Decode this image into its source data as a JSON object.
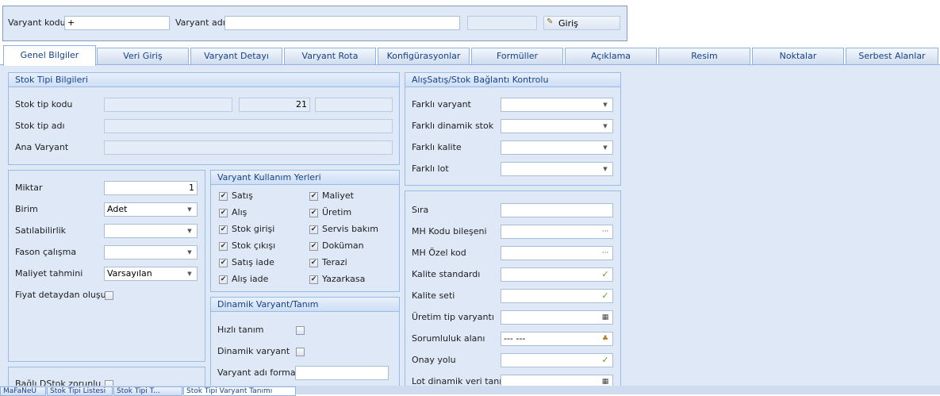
{
  "header": {
    "variant_code_label": "Varyant kodu",
    "variant_code_value": "+",
    "variant_name_label": "Varyant adı",
    "variant_name_value": "",
    "login_button": "Giriş",
    "login_icon": "pencil-edit-icon"
  },
  "tabs": [
    {
      "label": "Genel Bilgiler",
      "active": true
    },
    {
      "label": "Veri Giriş"
    },
    {
      "label": "Varyant Detayı"
    },
    {
      "label": "Varyant Rota"
    },
    {
      "label": "Konfigürasyonlar"
    },
    {
      "label": "Formüller"
    },
    {
      "label": "Açıklama"
    },
    {
      "label": "Resim"
    },
    {
      "label": "Noktalar"
    },
    {
      "label": "Serbest Alanlar"
    }
  ],
  "stock_type_panel": {
    "title": "Stok Tipi Bilgileri",
    "code_label": "Stok tip kodu",
    "code_value": "21",
    "name_label": "Stok tip adı",
    "main_variant_label": "Ana Varyant"
  },
  "general": {
    "quantity_label": "Miktar",
    "quantity_value": "1",
    "unit_label": "Birim",
    "unit_value": "Adet",
    "saleability_label": "Satılabilirlik",
    "saleability_value": "",
    "outsourcing_label": "Fason çalışma",
    "outsourcing_value": "",
    "cost_estimate_label": "Maliyet tahmini",
    "cost_estimate_value": "Varsayılan",
    "price_detail_label": "Fiyat detaydan oluşur",
    "linked_stock_label": "Bağlı DStok zorunlu"
  },
  "usage_panel": {
    "title": "Varyant Kullanım Yerleri",
    "left": [
      {
        "label": "Satış",
        "checked": true
      },
      {
        "label": "Alış",
        "checked": true
      },
      {
        "label": "Stok girişi",
        "checked": true
      },
      {
        "label": "Stok çıkışı",
        "checked": true
      },
      {
        "label": "Satış iade",
        "checked": true
      },
      {
        "label": "Alış iade",
        "checked": true
      }
    ],
    "right": [
      {
        "label": "Maliyet",
        "checked": true
      },
      {
        "label": "Üretim",
        "checked": true
      },
      {
        "label": "Servis bakım",
        "checked": true
      },
      {
        "label": "Doküman",
        "checked": true
      },
      {
        "label": "Terazi",
        "checked": true
      },
      {
        "label": "Yazarkasa",
        "checked": true
      }
    ]
  },
  "dynamic_panel": {
    "title": "Dinamik Varyant/Tanım",
    "quick_label": "Hızlı tanım",
    "dynamic_label": "Dinamik varyant",
    "format_label": "Varyant adı formatı"
  },
  "connection_panel": {
    "title": "AlışSatış/Stok Bağlantı Kontrolu",
    "rows": [
      {
        "label": "Farklı varyant"
      },
      {
        "label": "Farklı dinamik stok"
      },
      {
        "label": "Farklı kalite"
      },
      {
        "label": "Farklı lot"
      }
    ]
  },
  "right_fields": {
    "order_label": "Sıra",
    "mh_code_label": "MH Kodu bileşeni",
    "mh_special_label": "MH Özel kod",
    "quality_std_label": "Kalite standardı",
    "quality_set_label": "Kalite seti",
    "prod_type_label": "Üretim tip varyantı",
    "responsibility_label": "Sorumluluk alanı",
    "responsibility_value": "--- ---",
    "approval_label": "Onay yolu",
    "lot_dyn_label": "Lot dinamik veri tanımı",
    "ellipsis": "···"
  },
  "bottom_tabs": [
    {
      "label": "MaFaNeÜ"
    },
    {
      "label": "Stok Tipi Listesi"
    },
    {
      "label": "Stok Tipi T..."
    },
    {
      "label": "Stok Tipi Varyant Tanımı"
    }
  ],
  "colors": {
    "accent": "#15428b",
    "panel_bg": "#dfe8f6",
    "border": "#99bbe8",
    "check_green": "#5aa02c"
  }
}
